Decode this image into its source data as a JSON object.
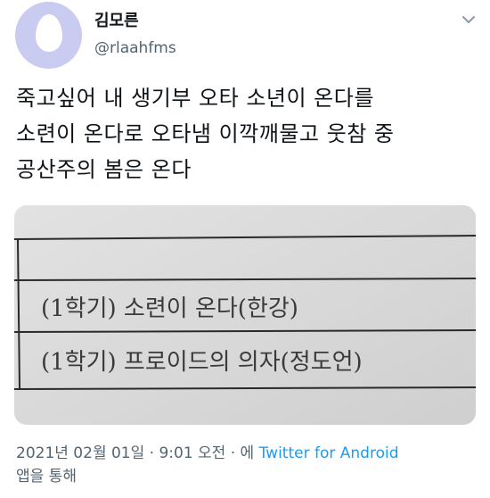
{
  "user": {
    "display_name": "김모른",
    "handle": "@rlaahfms"
  },
  "tweet": {
    "lines": [
      "죽고싶어 내 생기부 오타 소년이 온다를",
      "소련이 온다로 오타냄 이깍깨물고 웃참 중",
      "공산주의 봄은 온다"
    ]
  },
  "photo": {
    "row1": "(1학기) 소련이 온다(한강)",
    "row2": "(1학기) 프로이드의 의자(정도언)"
  },
  "meta": {
    "timestamp": "2021년 02월 01일 · 9:01 오전 · 에 ",
    "app": "Twitter for Android",
    "suffix": "앱을 통해"
  },
  "icons": {
    "avatar": "default-egg-avatar",
    "menu": "chevron-down-icon"
  },
  "colors": {
    "avatar_bg": "#c9cbf0",
    "link": "#1d9bf0",
    "muted": "#536471"
  }
}
